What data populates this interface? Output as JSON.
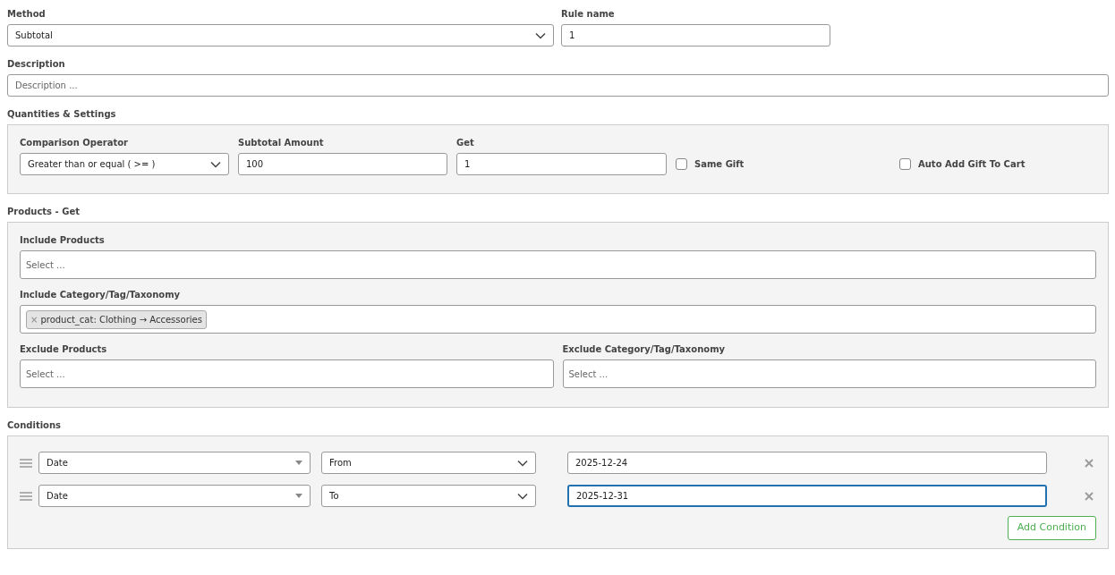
{
  "method": {
    "label": "Method",
    "value": "Subtotal"
  },
  "rule_name": {
    "label": "Rule name",
    "value": "1"
  },
  "description": {
    "label": "Description",
    "placeholder": "Description ..."
  },
  "quantities": {
    "title": "Quantities & Settings",
    "comparison_operator": {
      "label": "Comparison Operator",
      "value": "Greater than or equal ( >= )"
    },
    "subtotal_amount": {
      "label": "Subtotal Amount",
      "value": "100"
    },
    "get": {
      "label": "Get",
      "value": "1"
    },
    "checkboxes": [
      {
        "label": "Same Gift",
        "checked": false
      },
      {
        "label": "Auto Add Gift To Cart",
        "checked": false
      }
    ]
  },
  "products": {
    "title": "Products - Get",
    "include_products": {
      "label": "Include Products",
      "placeholder": "Select ..."
    },
    "include_category": {
      "label": "Include Category/Tag/Taxonomy",
      "tags": [
        "product_cat: Clothing → Accessories"
      ],
      "remove": "×"
    },
    "exclude_products": {
      "label": "Exclude Products",
      "placeholder": "Select ..."
    },
    "exclude_category": {
      "label": "Exclude Category/Tag/Taxonomy",
      "placeholder": "Select ..."
    }
  },
  "conditions": {
    "title": "Conditions",
    "rows": [
      {
        "type": "Date",
        "operator": "From",
        "value": "2025-12-24",
        "focused": false
      },
      {
        "type": "Date",
        "operator": "To",
        "value": "2025-12-31",
        "focused": true
      }
    ],
    "add_button": "Add Condition"
  }
}
